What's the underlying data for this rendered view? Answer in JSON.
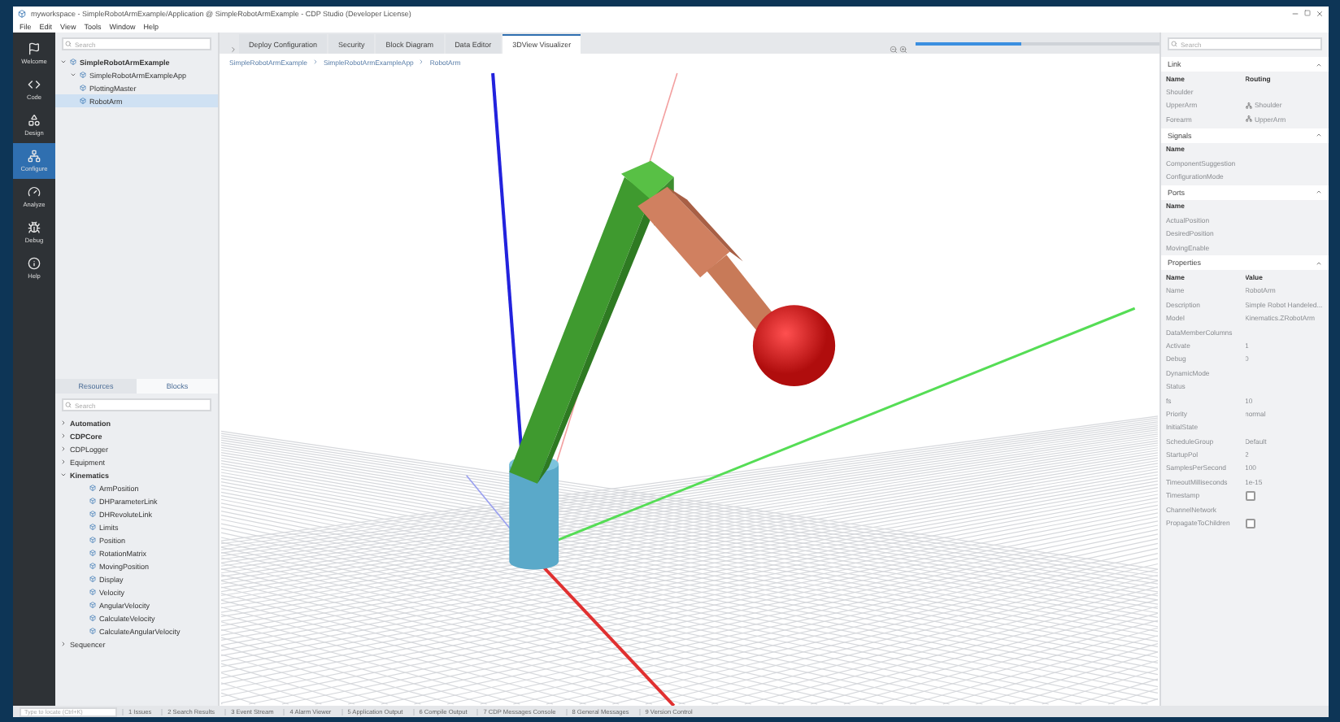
{
  "window": {
    "title": "myworkspace - SimpleRobotArmExample/Application @ SimpleRobotArmExample - CDP Studio (Developer License)"
  },
  "menu": [
    "File",
    "Edit",
    "View",
    "Tools",
    "Window",
    "Help"
  ],
  "modes": [
    {
      "label": "Welcome",
      "selected": false
    },
    {
      "label": "Code",
      "selected": false
    },
    {
      "label": "Design",
      "selected": false
    },
    {
      "label": "Configure",
      "selected": true
    },
    {
      "label": "Analyze",
      "selected": false
    },
    {
      "label": "Debug",
      "selected": false
    },
    {
      "label": "Help",
      "selected": false
    }
  ],
  "project_tree": {
    "search": {
      "placeholder": "Search"
    },
    "items": [
      {
        "label": "SimpleRobotArmExample",
        "selected": false,
        "children": [
          {
            "label": "SimpleRobotArmExampleApp",
            "selected": false,
            "children": [
              {
                "label": "PlottingMaster",
                "selected": false
              },
              {
                "label": "RobotArm",
                "selected": true
              }
            ]
          }
        ]
      }
    ]
  },
  "library": {
    "tabs": [
      {
        "label": "Resources",
        "selected": false
      },
      {
        "label": "Blocks",
        "selected": true
      }
    ],
    "search": {
      "placeholder": "Search"
    },
    "groups": [
      {
        "label": "Automation",
        "expanded": false,
        "emphasized": true
      },
      {
        "label": "CDPCore",
        "expanded": false,
        "emphasized": true
      },
      {
        "label": "CDPLogger",
        "expanded": false,
        "emphasized": false
      },
      {
        "label": "Equipment",
        "expanded": false,
        "emphasized": false
      },
      {
        "label": "Kinematics",
        "expanded": true,
        "emphasized": true,
        "items": [
          "ArmPosition",
          "DHParameterLink",
          "DHRevoluteLink",
          "Limits",
          "Position",
          "RotationMatrix",
          "MovingPosition",
          "Display",
          "Velocity",
          "AngularVelocity",
          "CalculateVelocity",
          "CalculateAngularVelocity"
        ]
      },
      {
        "label": "Sequencer",
        "expanded": false,
        "emphasized": false
      }
    ]
  },
  "editor_tabs": [
    {
      "label": "Deploy Configuration",
      "selected": false
    },
    {
      "label": "Security",
      "selected": false
    },
    {
      "label": "Block Diagram",
      "selected": false
    },
    {
      "label": "Data Editor",
      "selected": false
    },
    {
      "label": "3DView Visualizer",
      "selected": true
    }
  ],
  "zoom": {
    "level": 0.43
  },
  "breadcrumb": [
    "SimpleRobotArmExample",
    "SimpleRobotArmExampleApp",
    "RobotArm"
  ],
  "properties_panel": {
    "search": {
      "placeholder": "Search"
    },
    "sections": [
      {
        "title": "Link",
        "columns": [
          "Name",
          "Routing"
        ],
        "rows": [
          {
            "name": "Shoulder",
            "kind": "text",
            "value": ""
          },
          {
            "name": "UpperArm",
            "kind": "link",
            "value": "Shoulder"
          },
          {
            "name": "Forearm",
            "kind": "link",
            "value": "UpperArm"
          }
        ]
      },
      {
        "title": "Signals",
        "columns": [
          "Name"
        ],
        "rows": [
          {
            "name": "ComponentSuggestion",
            "kind": "text",
            "value": ""
          },
          {
            "name": "ConfigurationMode",
            "kind": "text",
            "value": ""
          }
        ]
      },
      {
        "title": "Ports",
        "columns": [
          "Name"
        ],
        "rows": [
          {
            "name": "ActualPosition",
            "kind": "text",
            "value": ""
          },
          {
            "name": "DesiredPosition",
            "kind": "text",
            "value": ""
          },
          {
            "name": "MovingEnable",
            "kind": "text",
            "value": ""
          }
        ]
      },
      {
        "title": "Properties",
        "columns": [
          "Name",
          "Value"
        ],
        "rows": [
          {
            "name": "Name",
            "kind": "text",
            "value": "RobotArm"
          },
          {
            "name": "Description",
            "kind": "text",
            "value": "Simple Robot Handeled..."
          },
          {
            "name": "Model",
            "kind": "text",
            "value": "Kinematics.ZRobotArm"
          },
          {
            "name": "DataMemberColumns",
            "kind": "text",
            "value": ""
          },
          {
            "name": "Activate",
            "kind": "text",
            "value": "1"
          },
          {
            "name": "Debug",
            "kind": "text",
            "value": "0"
          },
          {
            "name": "DynamicMode",
            "kind": "text",
            "value": ""
          },
          {
            "name": "Status",
            "kind": "text",
            "value": ""
          },
          {
            "name": "fs",
            "kind": "text",
            "value": "10"
          },
          {
            "name": "Priority",
            "kind": "text",
            "value": "normal"
          },
          {
            "name": "InitialState",
            "kind": "text",
            "value": ""
          },
          {
            "name": "ScheduleGroup",
            "kind": "text",
            "value": "Default"
          },
          {
            "name": "StartupPol",
            "kind": "text",
            "value": "2"
          },
          {
            "name": "SamplesPerSecond",
            "kind": "text",
            "value": "100"
          },
          {
            "name": "TimeoutMilliseconds",
            "kind": "text",
            "value": "1e-15"
          },
          {
            "name": "Timestamp",
            "kind": "checkbox",
            "checked": false
          },
          {
            "name": "ChannelNetwork",
            "kind": "text",
            "value": ""
          },
          {
            "name": "PropagateToChildren",
            "kind": "checkbox",
            "checked": false
          }
        ]
      }
    ]
  },
  "status_bar": {
    "locator": {
      "placeholder": "Type to locate (Ctrl+K)"
    },
    "panes": [
      "1 Issues",
      "2 Search Results",
      "3 Event Stream",
      "4 Alarm Viewer",
      "5 Application Output",
      "6 Compile Output",
      "7 CDP Messages Console",
      "8 General Messages",
      "9 Version Control"
    ]
  }
}
